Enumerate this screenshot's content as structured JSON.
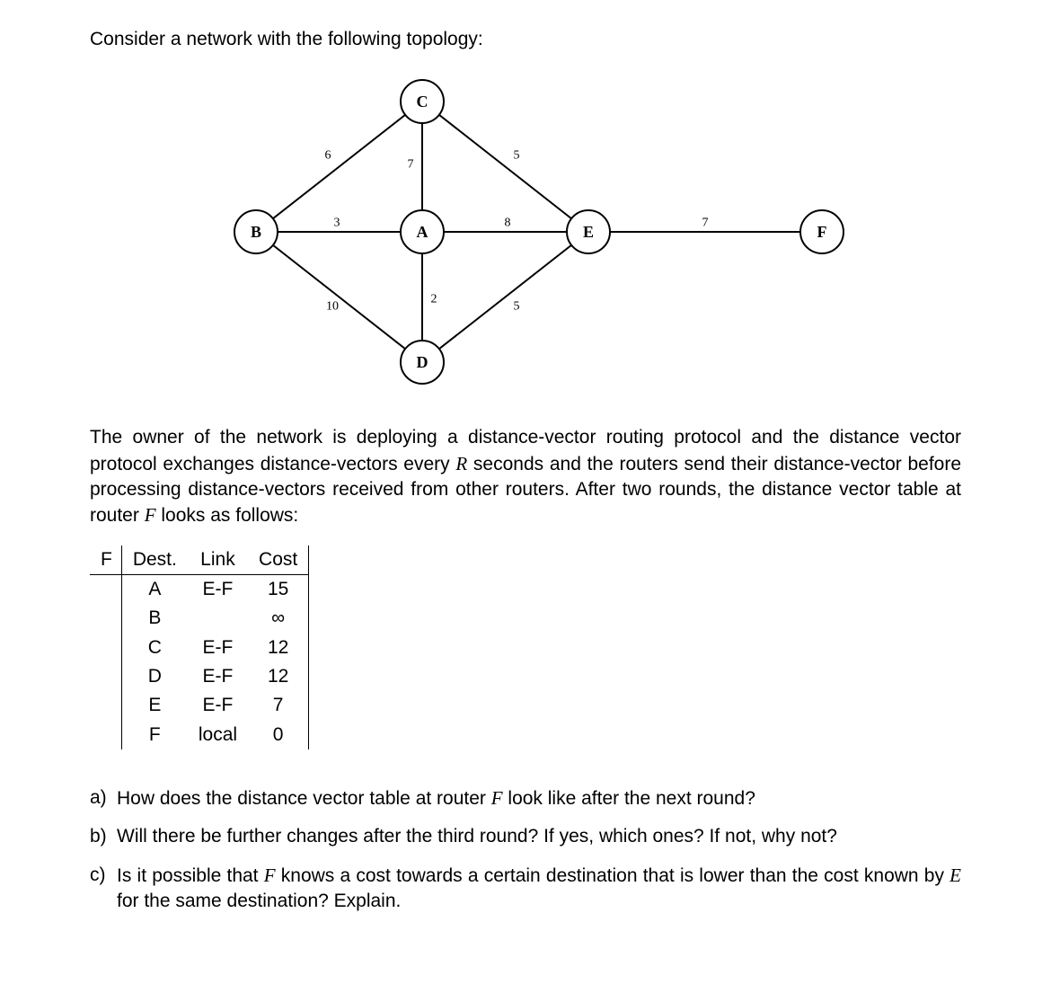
{
  "intro": "Consider a network with the following topology:",
  "diagram": {
    "nodes": {
      "A": "A",
      "B": "B",
      "C": "C",
      "D": "D",
      "E": "E",
      "F": "F"
    },
    "edges": {
      "BC": "6",
      "BA": "3",
      "BD": "10",
      "CA": "7",
      "CE": "5",
      "AD": "2",
      "AE": "8",
      "DE": "5",
      "EF": "7"
    }
  },
  "explain": {
    "p1a": "The owner of the network is deploying a distance-vector routing protocol and the distance vector protocol exchanges distance-vectors every ",
    "Rvar": "R",
    "p1b": " seconds and the routers send their distance-vector before processing distance-vectors received from other routers.  After two rounds, the distance vector table at router ",
    "Fvar": "F",
    "p1c": " looks as follows:"
  },
  "table": {
    "router": "F",
    "headers": {
      "dest": "Dest.",
      "link": "Link",
      "cost": "Cost"
    },
    "rows": [
      {
        "dest": "A",
        "link": "E-F",
        "cost": "15"
      },
      {
        "dest": "B",
        "link": "",
        "cost": "∞"
      },
      {
        "dest": "C",
        "link": "E-F",
        "cost": "12"
      },
      {
        "dest": "D",
        "link": "E-F",
        "cost": "12"
      },
      {
        "dest": "E",
        "link": "E-F",
        "cost": "7"
      },
      {
        "dest": "F",
        "link": "local",
        "cost": "0"
      }
    ]
  },
  "questions": {
    "a": {
      "label": "a)",
      "pre": "How does the distance vector table at router ",
      "var": "F",
      "post": " look like after the next round?"
    },
    "b": {
      "label": "b)",
      "text": "Will there be further changes after the third round? If yes, which ones? If not, why not?"
    },
    "c": {
      "label": "c)",
      "pre": "Is it possible that ",
      "var1": "F",
      "mid": " knows a cost towards a certain destination that is lower than the cost known by ",
      "var2": "E",
      "post": " for the same destination? Explain."
    }
  }
}
